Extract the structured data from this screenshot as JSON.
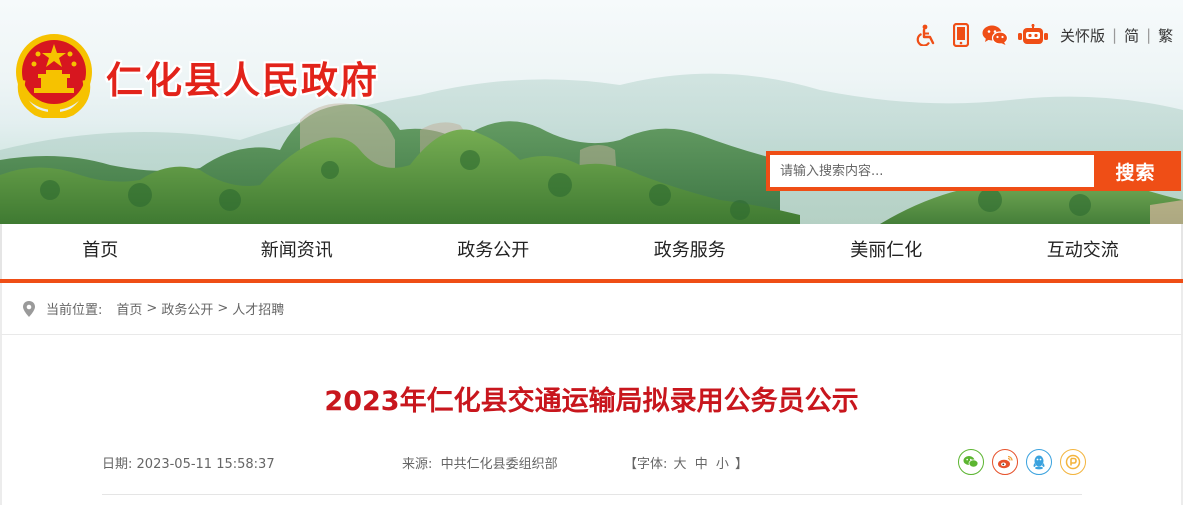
{
  "header": {
    "site_title": "仁化县人民政府",
    "search": {
      "placeholder": "请输入搜索内容...",
      "button_label": "搜索"
    },
    "top_links": {
      "care_version": "关怀版",
      "simplified": "简",
      "traditional": "繁"
    },
    "top_icons": [
      "accessibility-icon",
      "mobile-icon",
      "wechat-icon",
      "robot-icon"
    ],
    "accent_color": "#ef4e16",
    "title_color": "#e2231a"
  },
  "nav": {
    "items": [
      {
        "label": "首页"
      },
      {
        "label": "新闻资讯"
      },
      {
        "label": "政务公开"
      },
      {
        "label": "政务服务"
      },
      {
        "label": "美丽仁化"
      },
      {
        "label": "互动交流"
      }
    ]
  },
  "breadcrumb": {
    "label": "当前位置:",
    "items": [
      "首页",
      "政务公开",
      "人才招聘"
    ],
    "separator": ">"
  },
  "article": {
    "title": "2023年仁化县交通运输局拟录用公务员公示",
    "title_color": "#c8161d",
    "date_label": "日期:",
    "date": "2023-05-11 15:58:37",
    "source_label": "来源:",
    "source": "中共仁化县委组织部",
    "font_open": "【字体:",
    "font_large": "大",
    "font_medium": "中",
    "font_small": "小",
    "font_close": "】",
    "share": [
      {
        "name": "wechat-share",
        "color": "#5cb531"
      },
      {
        "name": "weibo-share",
        "color": "#e6512b"
      },
      {
        "name": "qq-share",
        "color": "#3aa2de"
      },
      {
        "name": "qzone-share",
        "color": "#f3b43d"
      }
    ]
  }
}
